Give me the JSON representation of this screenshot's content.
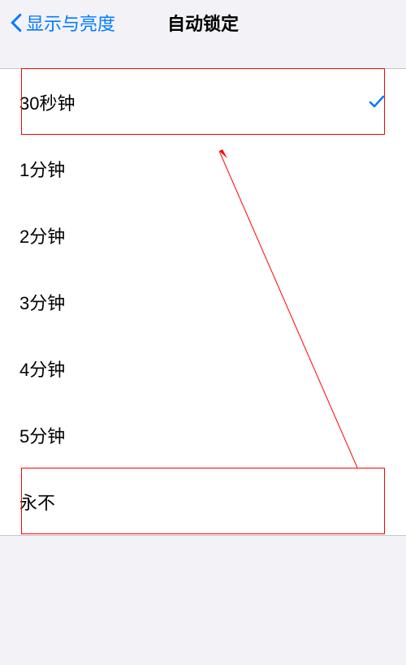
{
  "header": {
    "back_label": "显示与亮度",
    "title": "自动锁定"
  },
  "options": [
    {
      "label": "30秒钟",
      "selected": true
    },
    {
      "label": "1分钟",
      "selected": false
    },
    {
      "label": "2分钟",
      "selected": false
    },
    {
      "label": "3分钟",
      "selected": false
    },
    {
      "label": "4分钟",
      "selected": false
    },
    {
      "label": "5分钟",
      "selected": false
    },
    {
      "label": "永不",
      "selected": false
    }
  ],
  "annotation": {
    "highlight_first": true,
    "highlight_last": true,
    "arrow_color": "#ff0000"
  }
}
